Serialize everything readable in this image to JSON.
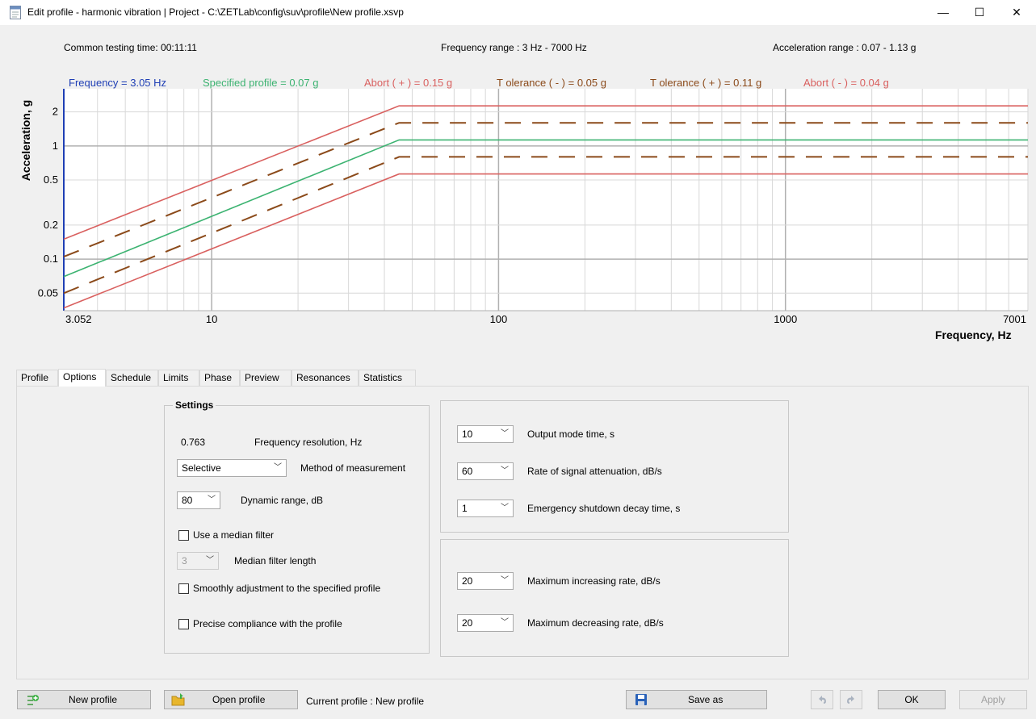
{
  "window": {
    "title": "Edit profile - harmonic vibration | Project - C:\\ZETLab\\config\\suv\\profile\\New profile.xsvp",
    "minimize": "—",
    "maximize": "☐",
    "close": "✕"
  },
  "info": {
    "testing_time": "Common testing time: 00:11:11",
    "freq_range": "Frequency range : 3 Hz - 7000 Hz",
    "accel_range": "Acceleration range : 0.07 - 1.13 g"
  },
  "readouts": {
    "frequency": "Frequency = 3.05 Hz",
    "specified": "Specified profile  = 0.07 g",
    "abort_plus": "Abort ( + )  = 0.15 g",
    "tol_minus": "T olerance ( - )  = 0.05 g",
    "tol_plus": "T olerance ( + )  = 0.11 g",
    "abort_minus": "Abort ( - )  = 0.04 g"
  },
  "chart_data": {
    "type": "line",
    "xlabel": "Frequency, Hz",
    "ylabel": "Acceleration, g",
    "x_scale": "log",
    "y_scale": "log",
    "xlim": [
      3.052,
      7001
    ],
    "ylim": [
      0.035,
      3.2
    ],
    "x_ticks": [
      "3.052",
      "10",
      "100",
      "1000",
      "7001"
    ],
    "y_ticks": [
      "2",
      "1",
      "0.5",
      "0.2",
      "0.1",
      "0.05"
    ],
    "grid": true,
    "series": [
      {
        "name": "Specified profile",
        "color": "#3cb371",
        "style": "solid",
        "x": [
          3.052,
          45,
          7001
        ],
        "y": [
          0.07,
          1.13,
          1.13
        ]
      },
      {
        "name": "Abort (+)",
        "color": "#d9605f",
        "style": "solid",
        "x": [
          3.052,
          45,
          7001
        ],
        "y": [
          0.15,
          2.26,
          2.26
        ]
      },
      {
        "name": "Abort (-)",
        "color": "#d9605f",
        "style": "solid",
        "x": [
          3.052,
          45,
          7001
        ],
        "y": [
          0.037,
          0.565,
          0.565
        ]
      },
      {
        "name": "Tolerance (+)",
        "color": "#8b4a1a",
        "style": "dashed",
        "x": [
          3.052,
          45,
          7001
        ],
        "y": [
          0.105,
          1.6,
          1.6
        ]
      },
      {
        "name": "Tolerance (-)",
        "color": "#8b4a1a",
        "style": "dashed",
        "x": [
          3.052,
          45,
          7001
        ],
        "y": [
          0.05,
          0.8,
          0.8
        ]
      }
    ]
  },
  "tabs": [
    "Profile",
    "Options",
    "Schedule",
    "Limits",
    "Phase",
    "Preview",
    "Resonances",
    "Statistics"
  ],
  "active_tab": "Options",
  "settings": {
    "title": "Settings",
    "freq_res_value": "0.763",
    "freq_res_label": "Frequency resolution, Hz",
    "method_value": "Selective",
    "method_label": "Method of measurement",
    "dyn_value": "80",
    "dyn_label": "Dynamic range, dB",
    "median_filter_label": "Use a median filter",
    "median_len_value": "3",
    "median_len_label": "Median filter length",
    "smooth_label": "Smoothly adjustment to the specified profile",
    "precise_label": "Precise compliance with the profile"
  },
  "output": {
    "mode_time_value": "10",
    "mode_time_label": "Output mode time, s",
    "attenuation_value": "60",
    "attenuation_label": "Rate of signal attenuation, dB/s",
    "decay_value": "1",
    "decay_label": "Emergency shutdown decay time, s"
  },
  "rates": {
    "increase_value": "20",
    "increase_label": "Maximum increasing rate, dB/s",
    "decrease_value": "20",
    "decrease_label": "Maximum decreasing rate, dB/s"
  },
  "footer": {
    "new_profile": "New profile",
    "open_profile": "Open profile",
    "current_profile": "Current profile : New profile",
    "save_as": "Save as",
    "ok": "OK",
    "apply": "Apply"
  },
  "colors": {
    "frequency_text": "#1f3fb5",
    "specified": "#3cb371",
    "abort": "#d9605f",
    "tolerance": "#8b4a1a"
  }
}
